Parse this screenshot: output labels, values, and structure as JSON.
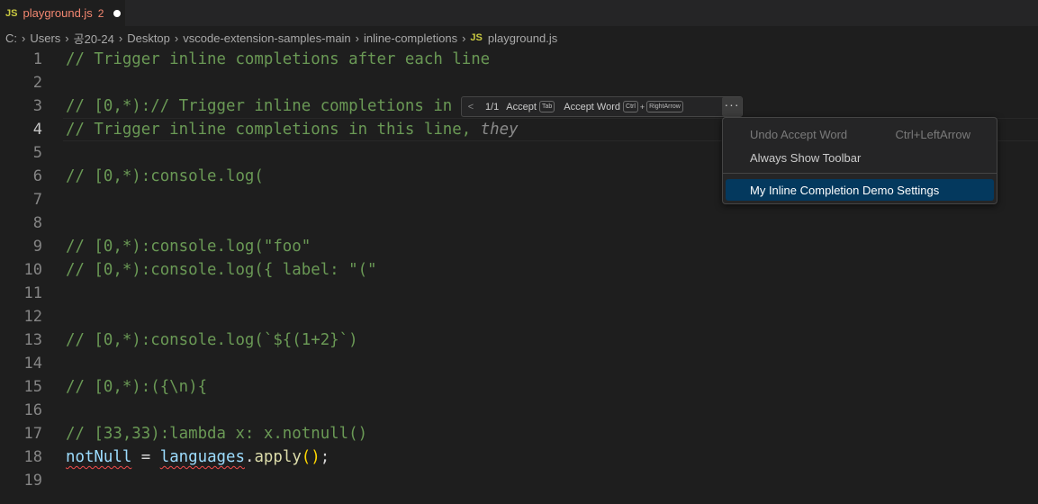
{
  "tab": {
    "badge": "JS",
    "filename": "playground.js",
    "problems_count": "2"
  },
  "breadcrumb": {
    "items": [
      "C:",
      "Users",
      "공20-24",
      "Desktop",
      "vscode-extension-samples-main",
      "inline-completions"
    ],
    "file_badge": "JS",
    "file": "playground.js"
  },
  "lines": [
    {
      "n": "1",
      "text": "// Trigger inline completions after each line"
    },
    {
      "n": "2",
      "text": ""
    },
    {
      "n": "3",
      "text": "// [0,*):// Trigger inline completions in"
    },
    {
      "n": "4",
      "text": "// Trigger inline completions in this line,",
      "ghost": " they"
    },
    {
      "n": "5",
      "text": ""
    },
    {
      "n": "6",
      "text": "// [0,*):console.log("
    },
    {
      "n": "7",
      "text": ""
    },
    {
      "n": "8",
      "text": ""
    },
    {
      "n": "9",
      "text": "// [0,*):console.log(\"foo\""
    },
    {
      "n": "10",
      "text": "// [0,*):console.log({ label: \"(\""
    },
    {
      "n": "11",
      "text": ""
    },
    {
      "n": "12",
      "text": ""
    },
    {
      "n": "13",
      "text": "// [0,*):console.log(`${(1+2}`)"
    },
    {
      "n": "14",
      "text": ""
    },
    {
      "n": "15",
      "text": "// [0,*):({\\n){"
    },
    {
      "n": "16",
      "text": ""
    },
    {
      "n": "17",
      "text": "// [33,33):lambda x: x.notnull()"
    },
    {
      "n": "18",
      "code": {
        "var1": "notNull",
        "eq": " = ",
        "var2": "languages",
        "dot": ".",
        "fn": "apply",
        "open": "(",
        "close": ")",
        "semi": ";"
      }
    },
    {
      "n": "19",
      "text": ""
    }
  ],
  "inline_toolbar": {
    "prev_icon": "chevron-left",
    "next_icon": "chevron-right",
    "counter": "1/1",
    "accept_label": "Accept",
    "accept_key": "Tab",
    "accept_word_label": "Accept Word",
    "accept_word_key1": "Ctrl",
    "accept_word_plus": "+",
    "accept_word_key2": "RightArrow",
    "more_icon": "ellipsis"
  },
  "context_menu": {
    "items": [
      {
        "label": "Undo Accept Word",
        "shortcut": "Ctrl+LeftArrow",
        "state": "disabled"
      },
      {
        "label": "Always Show Toolbar",
        "shortcut": "",
        "state": "enabled"
      },
      {
        "label": "My Inline Completion Demo Settings",
        "shortcut": "",
        "state": "selected"
      }
    ]
  },
  "colors": {
    "editor_bg": "#1e1e1e",
    "comment": "#6a9955",
    "error": "#f48771",
    "menu_selected": "#04395e"
  }
}
